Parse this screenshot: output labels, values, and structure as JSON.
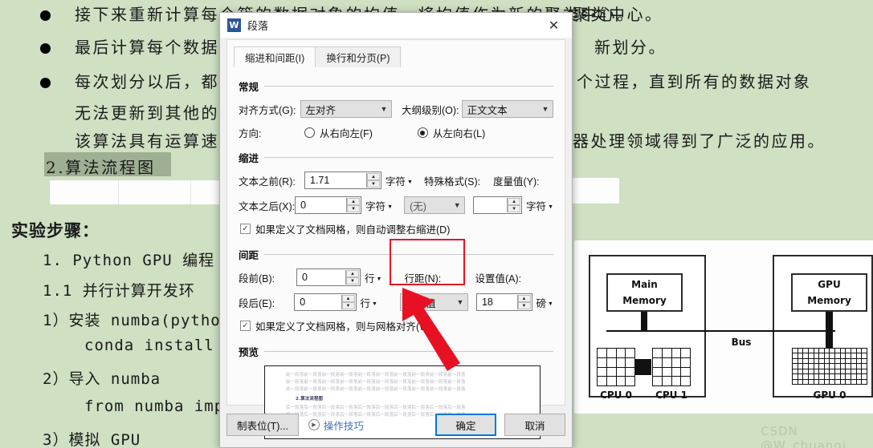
{
  "document": {
    "bullets": [
      "接下来重新计算每个簇的数据对象的均值，将均值作为新的聚类中心。",
      "最后计算每个数据对象到新划分。",
      "每次划分以后，都需要重复整个过程，直到所有的数据对象"
    ],
    "cont_lines": [
      "无法更新到其他的数据",
      "该算法具有运算速度器处理领域得到了广泛的应用。"
    ],
    "right_fragments": [
      "聚类中心。",
      "新划分。",
      "个过程，直到所有的数据对象",
      "器处理领域得到了广泛的应用。"
    ],
    "selected_heading": "2.算法流程图",
    "section_title": "实验步骤：",
    "steps": [
      "1. Python GPU 编程",
      "1.1 并行计算开发环",
      "1）安装 numba(pytho",
      "conda install",
      "2）导入 numba",
      "from numba imp",
      "3）模拟 GPU"
    ],
    "watermark": "CSDN @W_chuanqi"
  },
  "diagram": {
    "main_memory": "Main\nMemory",
    "main_memory_l1": "Main",
    "main_memory_l2": "Memory",
    "gpu_memory_l1": "GPU",
    "gpu_memory_l2": "Memory",
    "bus": "Bus",
    "cpu0": "CPU 0",
    "cpu1": "CPU 1",
    "gpu0": "GPU 0"
  },
  "dialog": {
    "app_icon": "W",
    "title": "段落",
    "close_icon": "✕",
    "tabs": [
      {
        "label": "缩进和间距(I)",
        "active": true
      },
      {
        "label": "换行和分页(P)",
        "active": false
      }
    ],
    "general": {
      "group_label": "常规",
      "alignment_label": "对齐方式(G):",
      "alignment_value": "左对齐",
      "outline_label": "大纲级别(O):",
      "outline_value": "正文文本",
      "direction_label": "方向:",
      "rtl_label": "从右向左(F)",
      "ltr_label": "从左向右(L)",
      "direction_selected": "ltr"
    },
    "indent": {
      "group_label": "缩进",
      "before_label": "文本之前(R):",
      "before_value": "1.71",
      "before_unit": "字符",
      "after_label": "文本之后(X):",
      "after_value": "0",
      "after_unit": "字符",
      "special_label": "特殊格式(S):",
      "special_value": "(无)",
      "measure_label": "度量值(Y):",
      "measure_value": "",
      "measure_unit": "字符",
      "checkbox_label": "如果定义了文档网格，则自动调整右缩进(D)",
      "checkbox_checked": true
    },
    "spacing": {
      "group_label": "间距",
      "before_label": "段前(B):",
      "before_value": "0",
      "before_unit": "行",
      "after_label": "段后(E):",
      "after_value": "0",
      "after_unit": "行",
      "line_spacing_label": "行距(N):",
      "line_spacing_value": "固定值",
      "set_value_label": "设置值(A):",
      "set_value": "18",
      "set_value_unit": "磅",
      "checkbox_label": "如果定义了文档网格，则与网格对齐(W)",
      "checkbox_checked": true
    },
    "preview": {
      "group_label": "预览",
      "before_line": "前一段落前一段落前一段落前一段落前一段落前一段落前一段落前一段落前一段落前一段落",
      "current_line": "2.算法流程图",
      "after_line": "后一段落后一段落后一段落后一段落后一段落后一段落后一段落后一段落后一段落后一段落"
    },
    "footer": {
      "tabs_button": "制表位(T)...",
      "tips_link": "操作技巧",
      "tips_icon": "▶",
      "ok_button": "确定",
      "cancel_button": "取消"
    }
  },
  "annotation": {
    "highlight_color": "#e81123",
    "arrow_color": "#e81123"
  }
}
